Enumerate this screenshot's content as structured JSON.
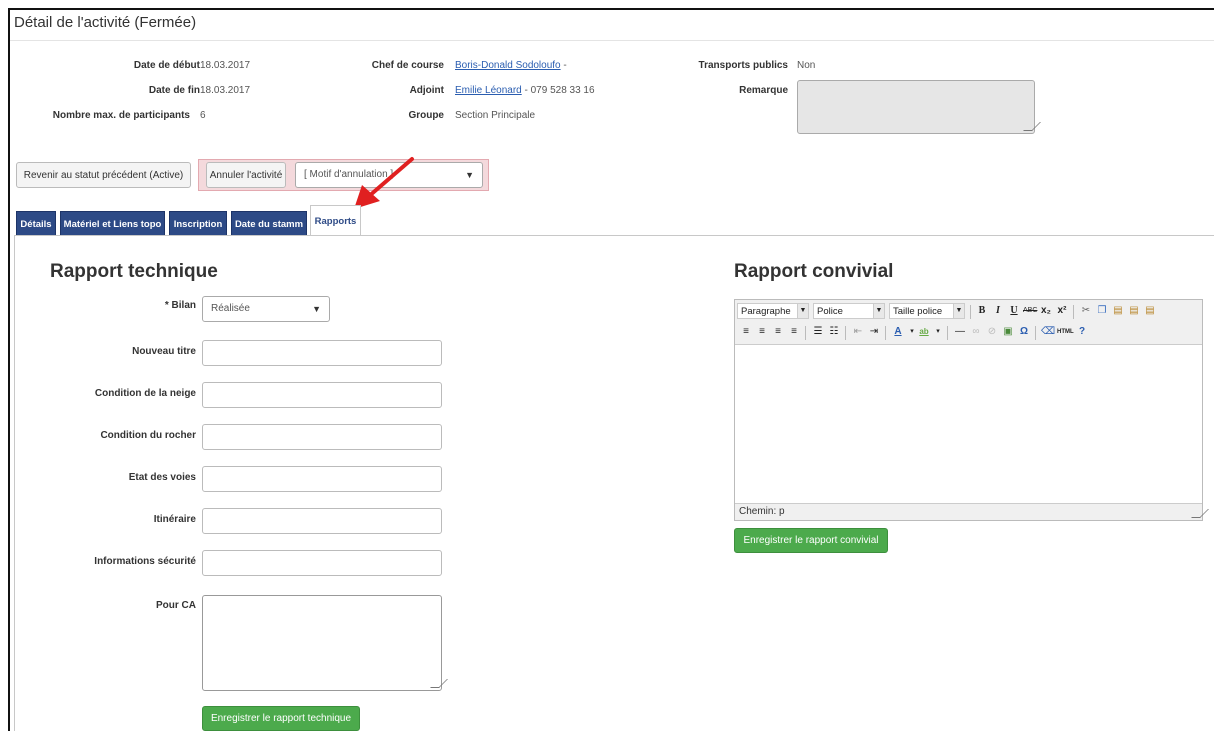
{
  "page": {
    "title": "Détail de l'activité  (Fermée)"
  },
  "info": {
    "date_debut_label": "Date de début",
    "date_debut": "18.03.2017",
    "date_fin_label": "Date de fin",
    "date_fin": "18.03.2017",
    "max_participants_label": "Nombre max. de participants",
    "max_participants": "6",
    "chef_label": "Chef de course",
    "chef_name": "Boris-Donald Sodoloufo",
    "chef_suffix": " -",
    "adjoint_label": "Adjoint",
    "adjoint_name": "Emilie Léonard",
    "adjoint_phone": " - 079 528 33 16",
    "groupe_label": "Groupe",
    "groupe": "Section Principale",
    "transports_label": "Transports publics",
    "transports": "Non",
    "remarque_label": "Remarque"
  },
  "actions": {
    "revert_label": "Revenir au statut précédent (Active)",
    "cancel_label": "Annuler l'activité",
    "motif_placeholder": "[ Motif d'annulation ]",
    "caret": "▼"
  },
  "tabs": [
    {
      "label": "Détails"
    },
    {
      "label": "Matériel et Liens topo"
    },
    {
      "label": "Inscription"
    },
    {
      "label": "Date du stamm"
    },
    {
      "label": "Rapports"
    }
  ],
  "technique": {
    "heading": "Rapport technique",
    "bilan_label": "* Bilan",
    "bilan_value": "Réalisée",
    "fields": [
      {
        "label": "Nouveau titre",
        "value": ""
      },
      {
        "label": "Condition de la neige",
        "value": ""
      },
      {
        "label": "Condition du rocher",
        "value": ""
      },
      {
        "label": "Etat des voies",
        "value": ""
      },
      {
        "label": "Itinéraire",
        "value": ""
      },
      {
        "label": "Informations sécurité",
        "value": ""
      }
    ],
    "pour_ca_label": "Pour CA",
    "save_label": "Enregistrer le rapport technique"
  },
  "convivial": {
    "heading": "Rapport convivial",
    "paragraph_select": "Paragraphe",
    "font_select": "Police",
    "size_select": "Taille police",
    "status_path": "Chemin: p",
    "save_label": "Enregistrer le rapport convivial"
  },
  "colors": {
    "tab_bg": "#2d4a86",
    "green": "#4caa4c",
    "cancel_wrap": "#f4d9dc",
    "arrow": "#e02020"
  }
}
